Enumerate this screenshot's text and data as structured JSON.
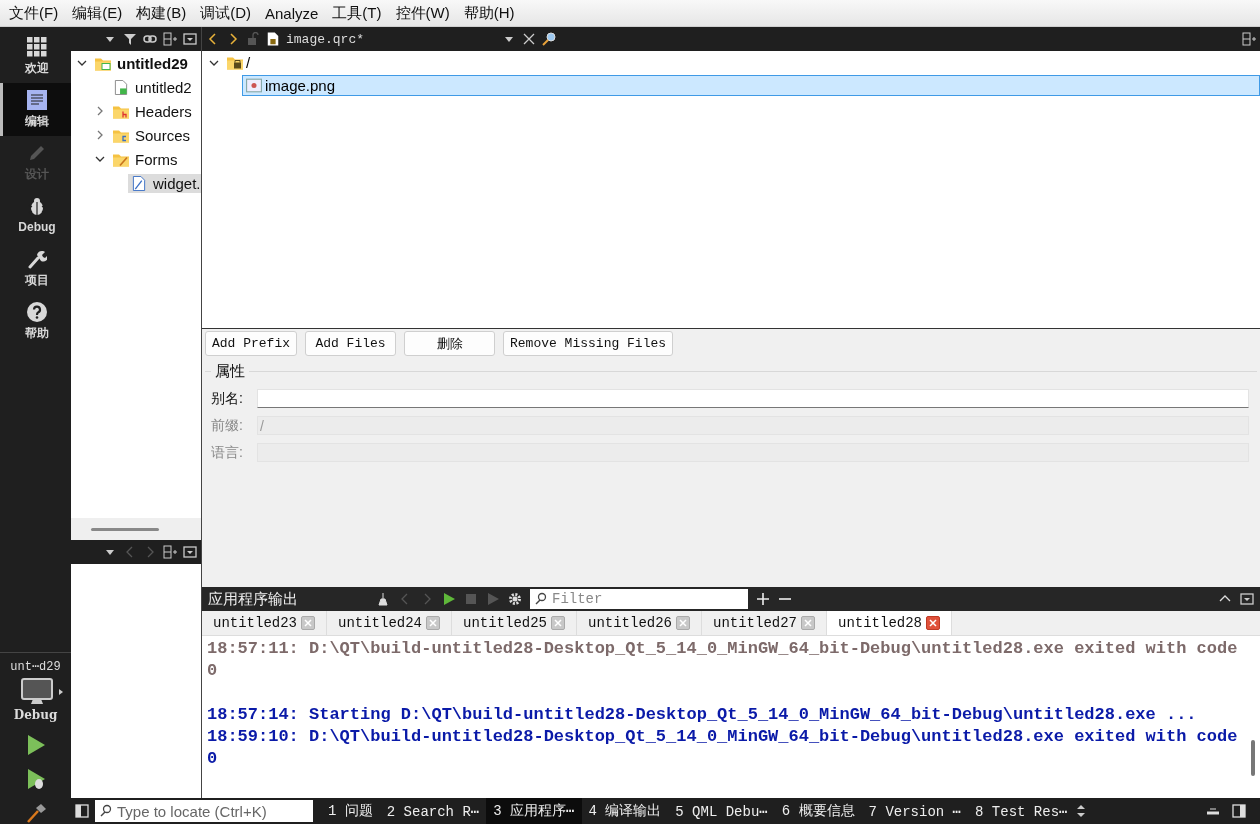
{
  "menu": [
    {
      "label": "文件(F)"
    },
    {
      "label": "编辑(E)"
    },
    {
      "label": "构建(B)"
    },
    {
      "label": "调试(D)"
    },
    {
      "label": "Analyze"
    },
    {
      "label": "工具(T)"
    },
    {
      "label": "控件(W)"
    },
    {
      "label": "帮助(H)"
    }
  ],
  "modes": [
    {
      "label": "欢迎",
      "kind": "grid",
      "selected": false,
      "disabled": false
    },
    {
      "label": "编辑",
      "kind": "document",
      "selected": true,
      "disabled": false
    },
    {
      "label": "设计",
      "kind": "pencil",
      "selected": false,
      "disabled": true
    },
    {
      "label": "Debug",
      "kind": "bug",
      "selected": false,
      "disabled": false
    },
    {
      "label": "项目",
      "kind": "wrench",
      "selected": false,
      "disabled": false
    },
    {
      "label": "帮助",
      "kind": "help",
      "selected": false,
      "disabled": false
    }
  ],
  "kit": {
    "project": "unt⋯d29",
    "build": "Debug"
  },
  "project_tree": [
    {
      "label": "untitled29",
      "kind": "project",
      "expanded": true,
      "selected": false,
      "children": [
        {
          "label": "untitled2",
          "kind": "profile",
          "selected": false
        },
        {
          "label": "Headers",
          "kind": "headers",
          "expanded": false,
          "selected": false
        },
        {
          "label": "Sources",
          "kind": "sources",
          "expanded": false,
          "selected": false
        },
        {
          "label": "Forms",
          "kind": "forms",
          "expanded": true,
          "selected": false,
          "children": [
            {
              "label": "widget.",
              "kind": "form",
              "selected": true
            }
          ]
        }
      ]
    }
  ],
  "editor": {
    "file": "image.qrc*",
    "resource_tree": [
      {
        "label": "/",
        "kind": "prefix",
        "expanded": true,
        "selected": false,
        "children": [
          {
            "label": "image.png",
            "kind": "image",
            "selected": true
          }
        ]
      }
    ],
    "buttons": [
      "Add Prefix",
      "Add Files",
      "删除",
      "Remove Missing Files"
    ],
    "properties": {
      "title": "属性",
      "fields": [
        {
          "label": "别名:",
          "disabled": false
        },
        {
          "label": "前缀:",
          "value": "/",
          "disabled": true
        },
        {
          "label": "语言:",
          "disabled": true
        }
      ]
    }
  },
  "output": {
    "title": "应用程序输出",
    "filter": {
      "placeholder": "Filter"
    },
    "tabs": [
      {
        "label": "untitled23",
        "selected": false
      },
      {
        "label": "untitled24",
        "selected": false
      },
      {
        "label": "untitled25",
        "selected": false
      },
      {
        "label": "untitled26",
        "selected": false
      },
      {
        "label": "untitled27",
        "selected": false
      },
      {
        "label": "untitled28",
        "selected": true
      }
    ],
    "lines": [
      {
        "kind": "exit",
        "text": "18:57:11: D:\\QT\\build-untitled28-Desktop_Qt_5_14_0_MinGW_64_bit-Debug\\untitled28.exe exited with code 0"
      },
      {
        "kind": "start",
        "text": "18:57:14: Starting D:\\QT\\build-untitled28-Desktop_Qt_5_14_0_MinGW_64_bit-Debug\\untitled28.exe ..."
      },
      {
        "kind": "start",
        "text": "18:59:10: D:\\QT\\build-untitled28-Desktop_Qt_5_14_0_MinGW_64_bit-Debug\\untitled28.exe exited with code 0"
      }
    ]
  },
  "status_bar": {
    "locator": {
      "placeholder": "Type to locate (Ctrl+K)"
    },
    "panes": [
      {
        "label": "1 问题",
        "selected": false
      },
      {
        "label": "2 Search R⋯",
        "selected": false
      },
      {
        "label": "3 应用程序⋯",
        "selected": true
      },
      {
        "label": "4 编译输出",
        "selected": false
      },
      {
        "label": "5 QML Debu⋯",
        "selected": false
      },
      {
        "label": "6 概要信息",
        "selected": false
      },
      {
        "label": "7 Version ⋯",
        "selected": false
      },
      {
        "label": "8 Test Res⋯",
        "selected": false
      }
    ]
  }
}
